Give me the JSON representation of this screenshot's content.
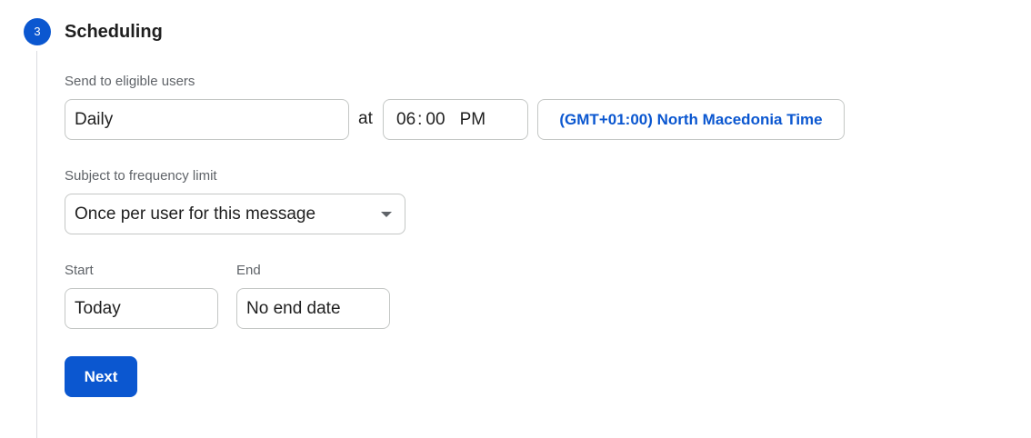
{
  "step": {
    "number": "3",
    "title": "Scheduling"
  },
  "send": {
    "label": "Send to eligible users",
    "frequency_value": "Daily",
    "at_text": "at",
    "time": {
      "hours": "06",
      "separator": ":",
      "minutes": "00",
      "period": "PM"
    },
    "timezone_label": "(GMT+01:00) North Macedonia Time"
  },
  "frequency_limit": {
    "label": "Subject to frequency limit",
    "selected": "Once per user for this message"
  },
  "dates": {
    "start_label": "Start",
    "start_value": "Today",
    "end_label": "End",
    "end_value": "No end date"
  },
  "actions": {
    "next_label": "Next"
  },
  "colors": {
    "accent": "#0b57d0",
    "border": "#c4c7c5",
    "label_text": "#5f6368"
  },
  "icons": {
    "dropdown": "caret-down-icon"
  }
}
